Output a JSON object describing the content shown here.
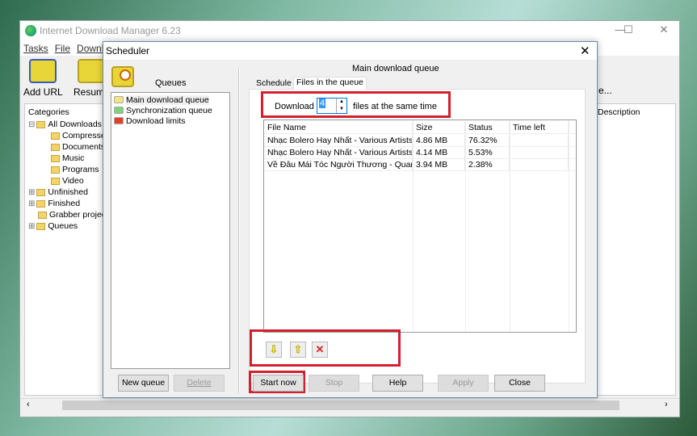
{
  "main_window": {
    "title": "Internet Download Manager 6.23",
    "menu": [
      "Tasks",
      "File",
      "Downlo"
    ],
    "toolbar": [
      "Add URL",
      "Resume",
      "e..."
    ],
    "categories_label": "Categories",
    "tree": [
      {
        "label": "All Downloads",
        "level": 0,
        "expander": "minus"
      },
      {
        "label": "Compressed",
        "level": 1
      },
      {
        "label": "Documents",
        "level": 1
      },
      {
        "label": "Music",
        "level": 1
      },
      {
        "label": "Programs",
        "level": 1
      },
      {
        "label": "Video",
        "level": 1
      },
      {
        "label": "Unfinished",
        "level": 0,
        "expander": "plus"
      },
      {
        "label": "Finished",
        "level": 0,
        "expander": "plus"
      },
      {
        "label": "Grabber project",
        "level": 0
      },
      {
        "label": "Queues",
        "level": 0,
        "expander": "plus"
      }
    ],
    "description_header": "Description"
  },
  "scheduler": {
    "title": "Scheduler",
    "queues_label": "Queues",
    "queues": [
      {
        "label": "Main download queue",
        "color": "#f2e28a"
      },
      {
        "label": "Synchronization queue",
        "color": "#7fd07f"
      },
      {
        "label": "Download limits",
        "color": "#e04030"
      }
    ],
    "new_queue": "New queue",
    "delete": "Delete",
    "queue_title": "Main download queue",
    "tabs": [
      "Schedule",
      "Files in the queue"
    ],
    "active_tab": 1,
    "download_label": "Download",
    "concurrent": "4",
    "same_time_label": "files at the same time",
    "columns": [
      "File Name",
      "Size",
      "Status",
      "Time left"
    ],
    "files": [
      [
        "Nhạc Bolero Hay Nhất - Various Artists ...",
        "4.86  MB",
        "76.32%",
        ""
      ],
      [
        "Nhạc Bolero Hay Nhất - Various Artists ...",
        "4.14  MB",
        "5.53%",
        ""
      ],
      [
        "Về Đâu Mái Tóc Người Thương - Quan...",
        "3.94  MB",
        "2.38%",
        ""
      ]
    ],
    "buttons": {
      "start": "Start now",
      "stop": "Stop",
      "help": "Help",
      "apply": "Apply",
      "close": "Close"
    },
    "highlight_color": "#d3202f"
  }
}
